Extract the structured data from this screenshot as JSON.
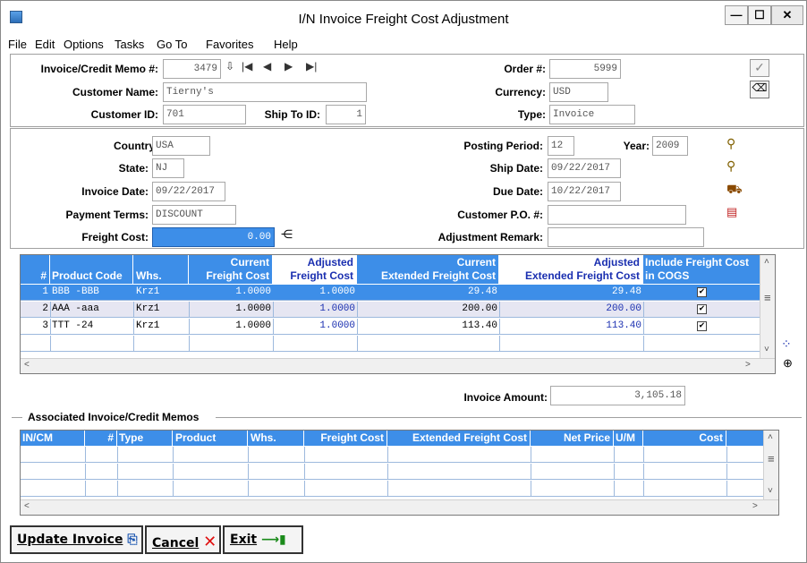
{
  "window": {
    "title": "I/N Invoice Freight Cost Adjustment"
  },
  "menu": [
    "File",
    "Edit",
    "Options",
    "Tasks",
    "Go To",
    "Favorites",
    "Help"
  ],
  "header": {
    "invoice_label": "Invoice/Credit Memo #:",
    "invoice_value": "3479",
    "order_label": "Order #:",
    "order_value": "5999",
    "customer_name_label": "Customer Name:",
    "customer_name_value": "Tierny's",
    "currency_label": "Currency:",
    "currency_value": "USD",
    "customer_id_label": "Customer ID:",
    "customer_id_value": "701",
    "ship_to_label": "Ship To ID:",
    "ship_to_value": "1",
    "type_label": "Type:",
    "type_value": "Invoice"
  },
  "details": {
    "country_label": "Country:",
    "country_value": "USA",
    "state_label": "State:",
    "state_value": "NJ",
    "invoice_date_label": "Invoice Date:",
    "invoice_date_value": "09/22/2017",
    "payment_terms_label": "Payment Terms:",
    "payment_terms_value": "DISCOUNT",
    "freight_cost_label": "Freight Cost:",
    "freight_cost_value": "0.00",
    "posting_period_label": "Posting Period:",
    "posting_period_value": "12",
    "year_label": "Year:",
    "year_value": "2009",
    "ship_date_label": "Ship Date:",
    "ship_date_value": "09/22/2017",
    "due_date_label": "Due Date:",
    "due_date_value": "10/22/2017",
    "customer_po_label": "Customer P.O. #:",
    "customer_po_value": "",
    "adjustment_remark_label": "Adjustment Remark:",
    "adjustment_remark_value": ""
  },
  "lines_grid": {
    "headers": {
      "num": "#",
      "product": "Product Code",
      "whs": "Whs.",
      "cur_freight": [
        "Current",
        "Freight Cost"
      ],
      "adj_freight": [
        "Adjusted",
        "Freight Cost"
      ],
      "cur_ext": [
        "Current",
        "Extended Freight Cost"
      ],
      "adj_ext": [
        "Adjusted",
        "Extended Freight Cost"
      ],
      "include": [
        "Include Freight Cost",
        "in COGS"
      ]
    },
    "rows": [
      {
        "num": "1",
        "product": "BBB -BBB",
        "whs": "Krz1",
        "cur_freight": "1.0000",
        "adj_freight": "1.0000",
        "cur_ext": "29.48",
        "adj_ext": "29.48",
        "include": "✔"
      },
      {
        "num": "2",
        "product": "AAA -aaa",
        "whs": "Krz1",
        "cur_freight": "1.0000",
        "adj_freight": "1.0000",
        "cur_ext": "200.00",
        "adj_ext": "200.00",
        "include": "✔"
      },
      {
        "num": "3",
        "product": "TTT -24",
        "whs": "Krz1",
        "cur_freight": "1.0000",
        "adj_freight": "1.0000",
        "cur_ext": "113.40",
        "adj_ext": "113.40",
        "include": "✔"
      }
    ]
  },
  "invoice_amount": {
    "label": "Invoice Amount:",
    "value": "3,105.18"
  },
  "assoc": {
    "title": "Associated Invoice/Credit Memos",
    "headers": [
      "IN/CM",
      "#",
      "Type",
      "Product",
      "Whs.",
      "Freight Cost",
      "Extended Freight Cost",
      "Net Price",
      "U/M",
      "Cost"
    ]
  },
  "buttons": {
    "update": "Update Invoice",
    "cancel": "Cancel",
    "exit": "Exit"
  },
  "colors": {
    "accent": "#3d8ee8",
    "adjusted_text": "#1a2fb0"
  }
}
